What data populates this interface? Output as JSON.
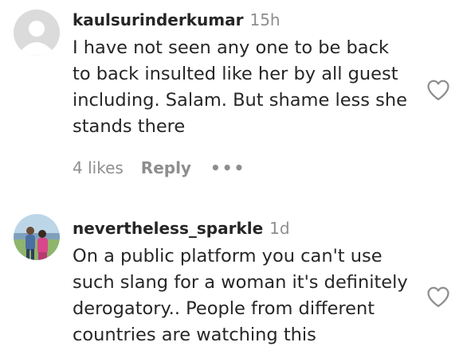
{
  "comments": [
    {
      "username": "kaulsurinderkumar",
      "time": "15h",
      "text_lines": [
        "I have not seen any one to be back",
        "to back insulted like her by all guest",
        "including. Salam. But shame less she",
        "stands there"
      ],
      "likes": "4 likes",
      "reply": "Reply",
      "more": "•••",
      "avatar_icon": "default-user-avatar-icon",
      "like_icon": "heart-outline-icon"
    },
    {
      "username": "nevertheless_sparkle",
      "time": "1d",
      "text_lines": [
        "On a public platform you can't use",
        "such slang for a woman it's definitely",
        "derogatory.. People from different",
        "countries are watching this"
      ],
      "avatar_icon": "user-photo-avatar-icon",
      "like_icon": "heart-outline-icon"
    }
  ],
  "colors": {
    "text": "#262626",
    "secondary": "#8e8e8e",
    "avatar_placeholder": "#dbdbdb"
  }
}
